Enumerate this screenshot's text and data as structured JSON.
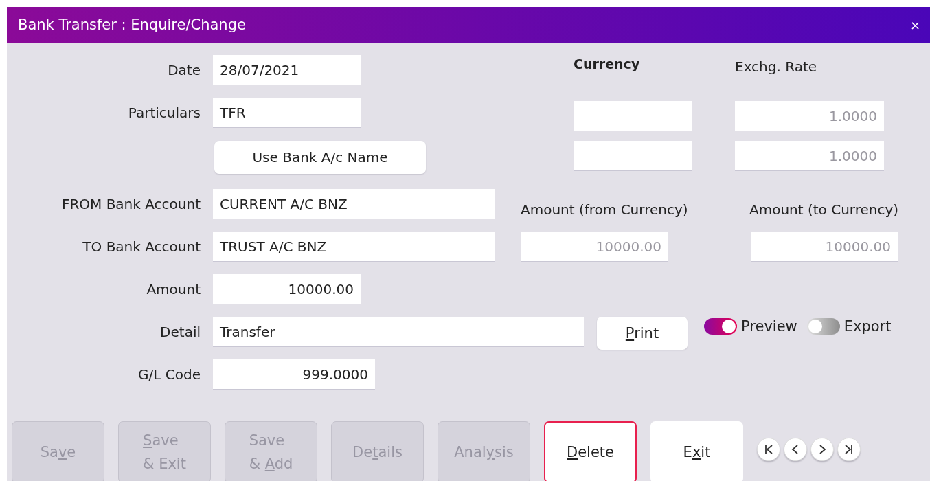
{
  "window": {
    "title": "Bank Transfer : Enquire/Change",
    "close": "×"
  },
  "date": {
    "label": "Date",
    "value": "28/07/2021"
  },
  "particulars": {
    "label": "Particulars",
    "value": "TFR"
  },
  "use_bank_name_button": "Use Bank A/c Name",
  "from_account": {
    "label": "FROM Bank Account",
    "value": "CURRENT A/C BNZ"
  },
  "to_account": {
    "label": "TO Bank Account",
    "value": "TRUST A/C BNZ"
  },
  "amount": {
    "label": "Amount",
    "value": "10000.00"
  },
  "detail": {
    "label": "Detail",
    "value": "Transfer"
  },
  "gl_code": {
    "label": "G/L Code",
    "value": "999.0000"
  },
  "currency_heading": "Currency",
  "exchange_rate": {
    "heading": "Exchg. Rate",
    "from": "1.0000",
    "to": "1.0000",
    "disabled": true
  },
  "amount_from_currency": {
    "label": "Amount (from Currency)",
    "value": "10000.00",
    "disabled": true
  },
  "amount_to_currency": {
    "label": "Amount (to Currency)",
    "value": "10000.00",
    "disabled": true
  },
  "print_button": {
    "key": "P",
    "after": "rint"
  },
  "toggles": [
    {
      "label": "Preview",
      "on": true
    },
    {
      "label": "Export",
      "on": false
    }
  ],
  "buttons": [
    {
      "before": "Sa",
      "key": "v",
      "after": "e",
      "disabled": true,
      "focused": false
    },
    {
      "key": "S",
      "after": "ave\n& Exit",
      "disabled": true,
      "focused": false
    },
    {
      "before": "Save\n& ",
      "key": "A",
      "after": "dd",
      "disabled": true,
      "focused": false
    },
    {
      "before": "De",
      "key": "t",
      "after": "ails",
      "disabled": true,
      "focused": false
    },
    {
      "before": "Anal",
      "key": "y",
      "after": "sis",
      "disabled": true,
      "focused": false
    },
    {
      "key": "D",
      "after": "elete",
      "disabled": false,
      "focused": true
    },
    {
      "before": "E",
      "key": "x",
      "after": "it",
      "disabled": false,
      "focused": false
    }
  ]
}
